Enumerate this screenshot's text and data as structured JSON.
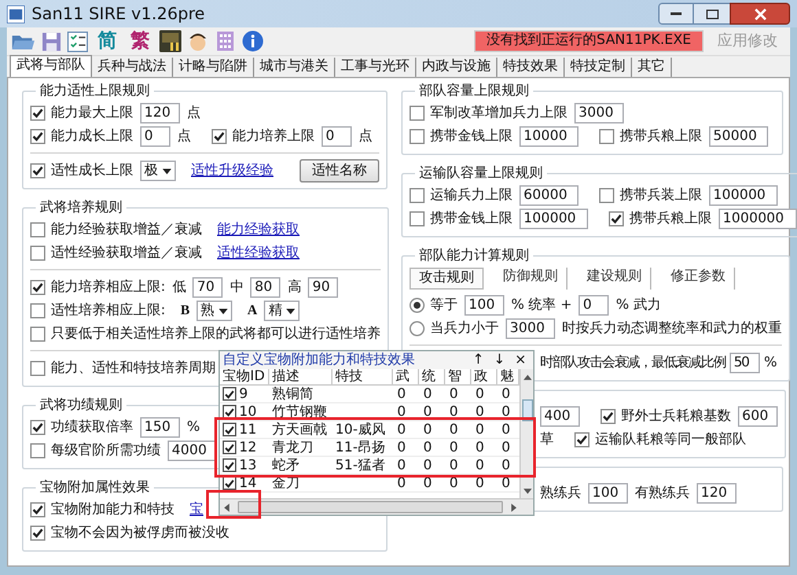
{
  "window": {
    "title": "San11 SIRE v1.26pre"
  },
  "toolbar": {
    "tools": [
      {
        "kind": "folder"
      },
      {
        "kind": "save"
      },
      {
        "kind": "list"
      },
      {
        "kind": "char",
        "label": "简",
        "color": "#138a9c"
      },
      {
        "kind": "char",
        "label": "繁",
        "color": "#b0246e"
      },
      {
        "kind": "game"
      },
      {
        "kind": "avatar"
      },
      {
        "kind": "binary"
      },
      {
        "kind": "info"
      }
    ],
    "status": "没有找到正运行的SAN11PK.EXE",
    "apply": {
      "label": "应用修改",
      "disabled": true
    }
  },
  "tabs": [
    {
      "label": "武将与部队",
      "selected": true
    },
    {
      "label": "兵种与战法",
      "selected": false
    },
    {
      "label": "计略与陷阱",
      "selected": false
    },
    {
      "label": "城市与港关",
      "selected": false
    },
    {
      "label": "工事与光环",
      "selected": false
    },
    {
      "label": "内政与设施",
      "selected": false
    },
    {
      "label": "特技效果",
      "selected": false
    },
    {
      "label": "特技定制",
      "selected": false
    },
    {
      "label": "其它",
      "selected": false
    }
  ],
  "left_groups": [
    {
      "title": "能力适性上限规则",
      "rows": [
        {
          "items": [
            {
              "kind": "check",
              "label": "能力最大上限",
              "checked": true
            },
            {
              "kind": "input",
              "value": "120"
            },
            {
              "kind": "text",
              "text": "点"
            }
          ]
        },
        {
          "items": [
            {
              "kind": "check",
              "label": "能力成长上限",
              "checked": true
            },
            {
              "kind": "input",
              "value": "0"
            },
            {
              "kind": "text",
              "text": "点"
            },
            {
              "kind": "check",
              "label": "能力培养上限",
              "checked": true
            },
            {
              "kind": "input",
              "value": "0"
            },
            {
              "kind": "text",
              "text": "点"
            }
          ]
        },
        {
          "kind": "separator"
        },
        {
          "items": [
            {
              "kind": "check",
              "label": "适性成长上限",
              "checked": true
            },
            {
              "kind": "select",
              "value": "极"
            },
            {
              "kind": "link",
              "text": "适性升级经验"
            },
            {
              "kind": "button",
              "label": "适性名称"
            }
          ]
        }
      ]
    },
    {
      "title": "武将培养规则",
      "rows": [
        {
          "items": [
            {
              "kind": "check",
              "label": "能力经验获取增益／衰减",
              "checked": false
            },
            {
              "kind": "link",
              "text": "能力经验获取"
            }
          ]
        },
        {
          "items": [
            {
              "kind": "check",
              "label": "适性经验获取增益／衰减",
              "checked": false
            },
            {
              "kind": "link",
              "text": "适性经验获取"
            }
          ]
        },
        {
          "kind": "separator"
        },
        {
          "items": [
            {
              "kind": "check",
              "label": "能力培养相应上限:",
              "checked": true
            },
            {
              "kind": "text",
              "text": "低"
            },
            {
              "kind": "input",
              "value": "70"
            },
            {
              "kind": "text",
              "text": "中"
            },
            {
              "kind": "input",
              "value": "80"
            },
            {
              "kind": "text",
              "text": "高"
            },
            {
              "kind": "input",
              "value": "90"
            }
          ]
        },
        {
          "items": [
            {
              "kind": "check",
              "label": "适性培养相应上限:",
              "checked": false
            },
            {
              "kind": "grade",
              "text": "B"
            },
            {
              "kind": "select",
              "value": "熟"
            },
            {
              "kind": "grade",
              "text": "A"
            },
            {
              "kind": "select",
              "value": "精"
            }
          ]
        },
        {
          "items": [
            {
              "kind": "check",
              "label": "只要低于相关适性培养上限的武将都可以进行适性培养",
              "checked": false
            }
          ]
        },
        {
          "kind": "separator"
        },
        {
          "items": [
            {
              "kind": "check",
              "label": "能力、适性和特技培养周期",
              "checked": false
            }
          ]
        }
      ]
    },
    {
      "title": "武将功绩规则",
      "rows": [
        {
          "items": [
            {
              "kind": "check",
              "label": "功绩获取倍率",
              "checked": true
            },
            {
              "kind": "input",
              "value": "150"
            },
            {
              "kind": "text",
              "text": "%"
            }
          ]
        },
        {
          "items": [
            {
              "kind": "check",
              "label": "每级官阶所需功绩",
              "checked": false
            },
            {
              "kind": "input",
              "value": "4000"
            }
          ]
        }
      ]
    },
    {
      "title": "宝物附加属性效果",
      "rows": [
        {
          "items": [
            {
              "kind": "check",
              "label": "宝物附加能力和特技",
              "checked": true
            },
            {
              "kind": "link",
              "text": "宝"
            }
          ]
        },
        {
          "items": [
            {
              "kind": "check",
              "label": "宝物不会因为被俘虏而被没收",
              "checked": true
            }
          ]
        }
      ]
    }
  ],
  "right_groups": [
    {
      "title": "部队容量上限规则",
      "rows": [
        {
          "items": [
            {
              "kind": "check",
              "label": "军制改革增加兵力上限",
              "checked": false
            },
            {
              "kind": "input",
              "value": "3000"
            }
          ]
        },
        {
          "items": [
            {
              "kind": "check",
              "label": "携带金钱上限",
              "checked": false
            },
            {
              "kind": "input",
              "value": "10000"
            },
            {
              "kind": "check",
              "label": "携带兵粮上限",
              "checked": false
            },
            {
              "kind": "input",
              "value": "50000"
            }
          ]
        }
      ]
    },
    {
      "title": "运输队容量上限规则",
      "rows": [
        {
          "items": [
            {
              "kind": "check",
              "label": "运输兵力上限",
              "checked": false
            },
            {
              "kind": "input",
              "value": "60000"
            },
            {
              "kind": "check",
              "label": "携带兵装上限",
              "checked": false
            },
            {
              "kind": "input",
              "value": "100000"
            }
          ]
        },
        {
          "items": [
            {
              "kind": "check",
              "label": "携带金钱上限",
              "checked": false
            },
            {
              "kind": "input",
              "value": "100000"
            },
            {
              "kind": "check",
              "label": "携带兵粮上限",
              "checked": true
            },
            {
              "kind": "input",
              "value": "1000000"
            }
          ]
        }
      ]
    },
    {
      "title": "部队能力计算规则",
      "rows": [
        {
          "kind": "tabs",
          "tabs": [
            {
              "label": "攻击规则",
              "selected": true
            },
            {
              "label": "防御规则",
              "selected": false
            },
            {
              "label": "建设规则",
              "selected": false
            },
            {
              "label": "修正参数",
              "selected": false
            }
          ]
        },
        {
          "items": [
            {
              "kind": "radio",
              "label": "等于",
              "selected": true
            },
            {
              "kind": "input",
              "value": "100"
            },
            {
              "kind": "text",
              "text": "% 统率 +"
            },
            {
              "kind": "input",
              "value": "0"
            },
            {
              "kind": "text",
              "text": "% 武力"
            }
          ]
        },
        {
          "items": [
            {
              "kind": "radio",
              "label": "当兵力小于",
              "selected": false
            },
            {
              "kind": "input",
              "value": "3000"
            },
            {
              "kind": "text",
              "text": "时按兵力动态调整统率和武力的权重"
            }
          ]
        },
        {
          "kind": "separator"
        },
        {
          "kind": "covered",
          "items": [
            {
              "kind": "text",
              "text": "时部队攻击会衰减，最低衰减比例"
            },
            {
              "kind": "input",
              "value": "50"
            },
            {
              "kind": "text",
              "text": "%"
            }
          ]
        }
      ]
    },
    {
      "kind": "covered",
      "rows": [
        {
          "items": [
            {
              "kind": "input",
              "value": "400"
            },
            {
              "kind": "check",
              "label": "野外士兵耗粮基数",
              "checked": true
            },
            {
              "kind": "input",
              "value": "600"
            }
          ]
        },
        {
          "items": [
            {
              "kind": "text",
              "text": "草"
            },
            {
              "kind": "check",
              "label": "运输队耗粮等同一般部队",
              "checked": true
            }
          ]
        }
      ]
    },
    {
      "kind": "covered",
      "rows": [
        {
          "items": [
            {
              "kind": "text",
              "text": "熟练兵"
            },
            {
              "kind": "input",
              "value": "100"
            },
            {
              "kind": "text",
              "text": "有熟练兵"
            },
            {
              "kind": "input",
              "value": "120"
            }
          ]
        }
      ]
    }
  ],
  "popup": {
    "title": "自定义宝物附加能力和特技效果",
    "controls": [
      "↑",
      "↓",
      "×"
    ],
    "columns": [
      "宝物ID",
      "描述",
      "特技",
      "武",
      "统",
      "智",
      "政",
      "魅"
    ],
    "rows": [
      {
        "checked": true,
        "id": "9",
        "desc": "熟铜简",
        "stats": [
          "0",
          "0",
          "0",
          "0",
          "0"
        ]
      },
      {
        "checked": true,
        "id": "10",
        "desc": "竹节钢鞭",
        "stats": [
          "0",
          "0",
          "0",
          "0",
          "0"
        ]
      },
      {
        "checked": true,
        "id": "11",
        "desc": "方天画戟",
        "skill": "10-威风",
        "stats": [
          "0",
          "0",
          "0",
          "0",
          "0"
        ]
      },
      {
        "checked": true,
        "id": "12",
        "desc": "青龙刀",
        "skill": "11-昂扬",
        "stats": [
          "0",
          "0",
          "0",
          "0",
          "0"
        ]
      },
      {
        "checked": true,
        "id": "13",
        "desc": "蛇矛",
        "skill": "51-猛者",
        "stats": [
          "0",
          "0",
          "0",
          "0",
          "0"
        ]
      },
      {
        "checked": true,
        "id": "14",
        "desc": "金刀",
        "stats": [
          "0",
          "0",
          "0",
          "0",
          "0"
        ]
      }
    ]
  }
}
